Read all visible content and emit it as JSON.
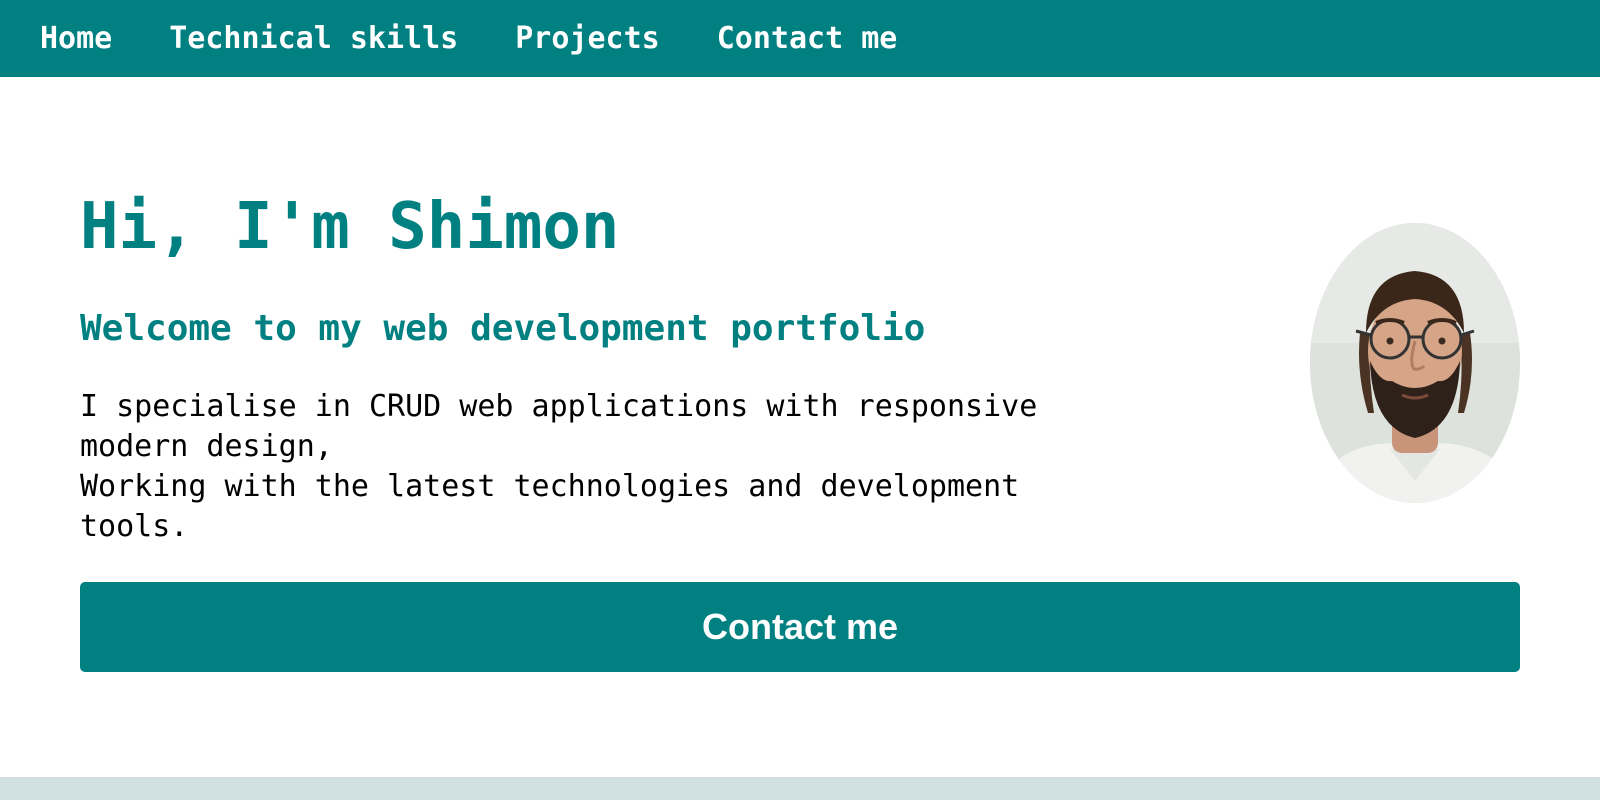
{
  "nav": {
    "items": [
      {
        "label": "Home"
      },
      {
        "label": "Technical skills"
      },
      {
        "label": "Projects"
      },
      {
        "label": "Contact me"
      }
    ]
  },
  "hero": {
    "title": "Hi, I'm Shimon",
    "subtitle": "Welcome to my web development portfolio",
    "description_lines": [
      "I specialise in CRUD web applications with responsive modern design,",
      "Working with the latest technologies and development tools."
    ],
    "cta_label": "Contact me",
    "avatar_icon": "profile-photo"
  },
  "colors": {
    "accent": "#008080",
    "footer": "#d1e1e1",
    "background": "#ffffff",
    "text": "#000000"
  }
}
